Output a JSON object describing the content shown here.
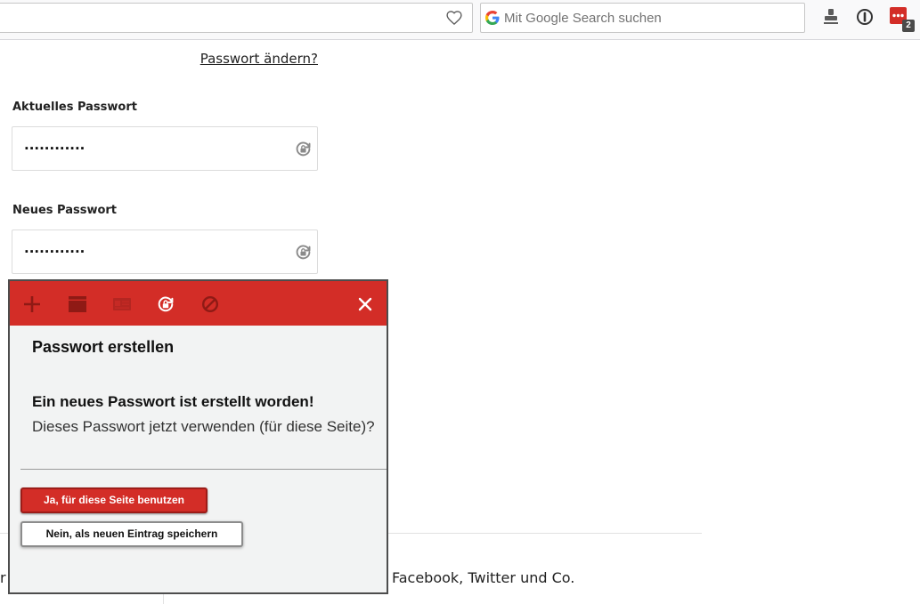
{
  "browser": {
    "search": {
      "placeholder": "Mit Google Search suchen",
      "engine_icon": "google-g-icon"
    },
    "bookmark_icon": "heart-icon",
    "toolbar_icons": [
      "stamp-icon",
      "onepassword-icon",
      "lastpass-icon"
    ],
    "lastpass_badge": "2"
  },
  "page": {
    "change_password_link": "Passwort ändern?",
    "current_password": {
      "label": "Aktuelles Passwort",
      "value": "············",
      "icon": "generate-password-icon"
    },
    "new_password": {
      "label": "Neues Passwort",
      "value": "············",
      "icon": "generate-password-icon"
    },
    "left_fragment": "r",
    "social_text": "Facebook, Twitter und Co."
  },
  "popup": {
    "toolbar_icons": [
      "add-icon",
      "site-icon",
      "form-fill-icon",
      "generate-password-icon",
      "never-icon",
      "close-icon"
    ],
    "title": "Passwort erstellen",
    "message_heading": "Ein neues Passwort ist erstellt worden!",
    "message_text": "Dieses Passwort jetzt verwenden (für diese Seite)?",
    "accept_button": "Ja, für diese Seite benutzen",
    "save_new_button": "Nein, als neuen Eintrag speichern"
  },
  "colors": {
    "accent_red": "#d32d27",
    "accent_dark_red": "#8f1a15",
    "popup_background": "#f2f3f3",
    "popup_border": "#4d4d4d",
    "text": "#222222"
  }
}
